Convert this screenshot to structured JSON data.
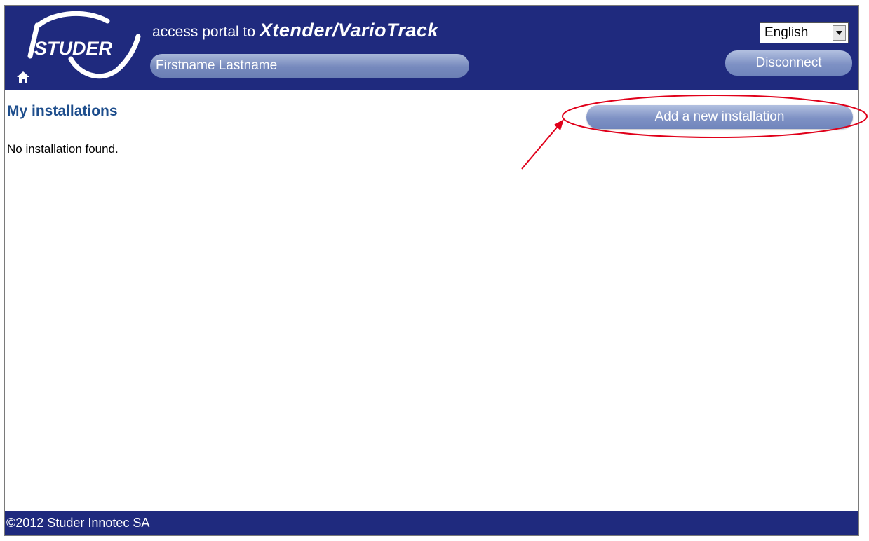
{
  "header": {
    "logo_text": "STUDER",
    "title_prefix": "access portal to ",
    "title_brand": "Xtender/VarioTrack",
    "user_name": "Firstname Lastname",
    "language": "English",
    "disconnect_label": "Disconnect",
    "home_icon": "home-icon"
  },
  "main": {
    "heading": "My installations",
    "add_button_label": "Add a new installation",
    "empty_message": "No installation found."
  },
  "footer": {
    "copyright": "©2012 Studer Innotec SA"
  },
  "colors": {
    "header_bg": "#1f2a7e",
    "heading_text": "#1d4d8c",
    "annotation_red": "#e0001a"
  }
}
